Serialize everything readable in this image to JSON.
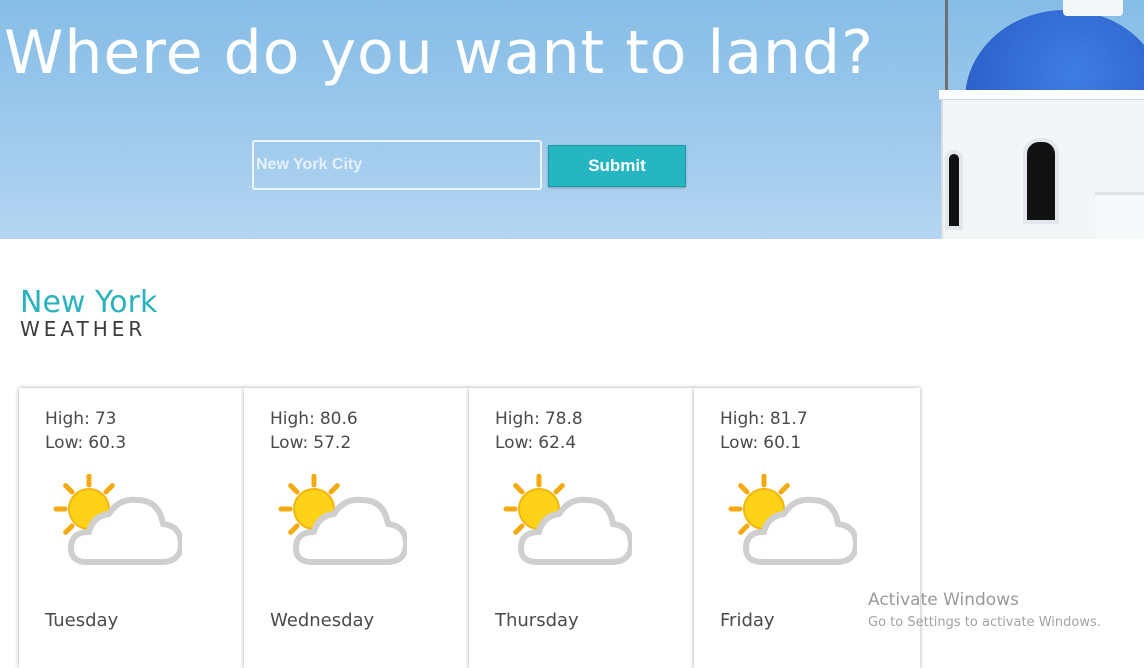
{
  "hero": {
    "title": "Where do you want to land?",
    "search": {
      "value": "",
      "placeholder": "New York City"
    },
    "submit_label": "Submit"
  },
  "weather": {
    "city": "New York",
    "label": "WEATHER",
    "high_label": "High:",
    "low_label": "Low:",
    "icon": "partly-cloudy-icon",
    "days": [
      {
        "day": "Tuesday",
        "high": "73",
        "low": "60.3"
      },
      {
        "day": "Wednesday",
        "high": "80.6",
        "low": "57.2"
      },
      {
        "day": "Thursday",
        "high": "78.8",
        "low": "62.4"
      },
      {
        "day": "Friday",
        "high": "81.7",
        "low": "60.1"
      }
    ]
  },
  "watermark": {
    "title": "Activate Windows",
    "subtitle": "Go to Settings to activate Windows."
  },
  "colors": {
    "accent": "#26b6c1",
    "city": "#2bb3bd",
    "sky": "#9ec9ec",
    "dome": "#2f66cf"
  }
}
